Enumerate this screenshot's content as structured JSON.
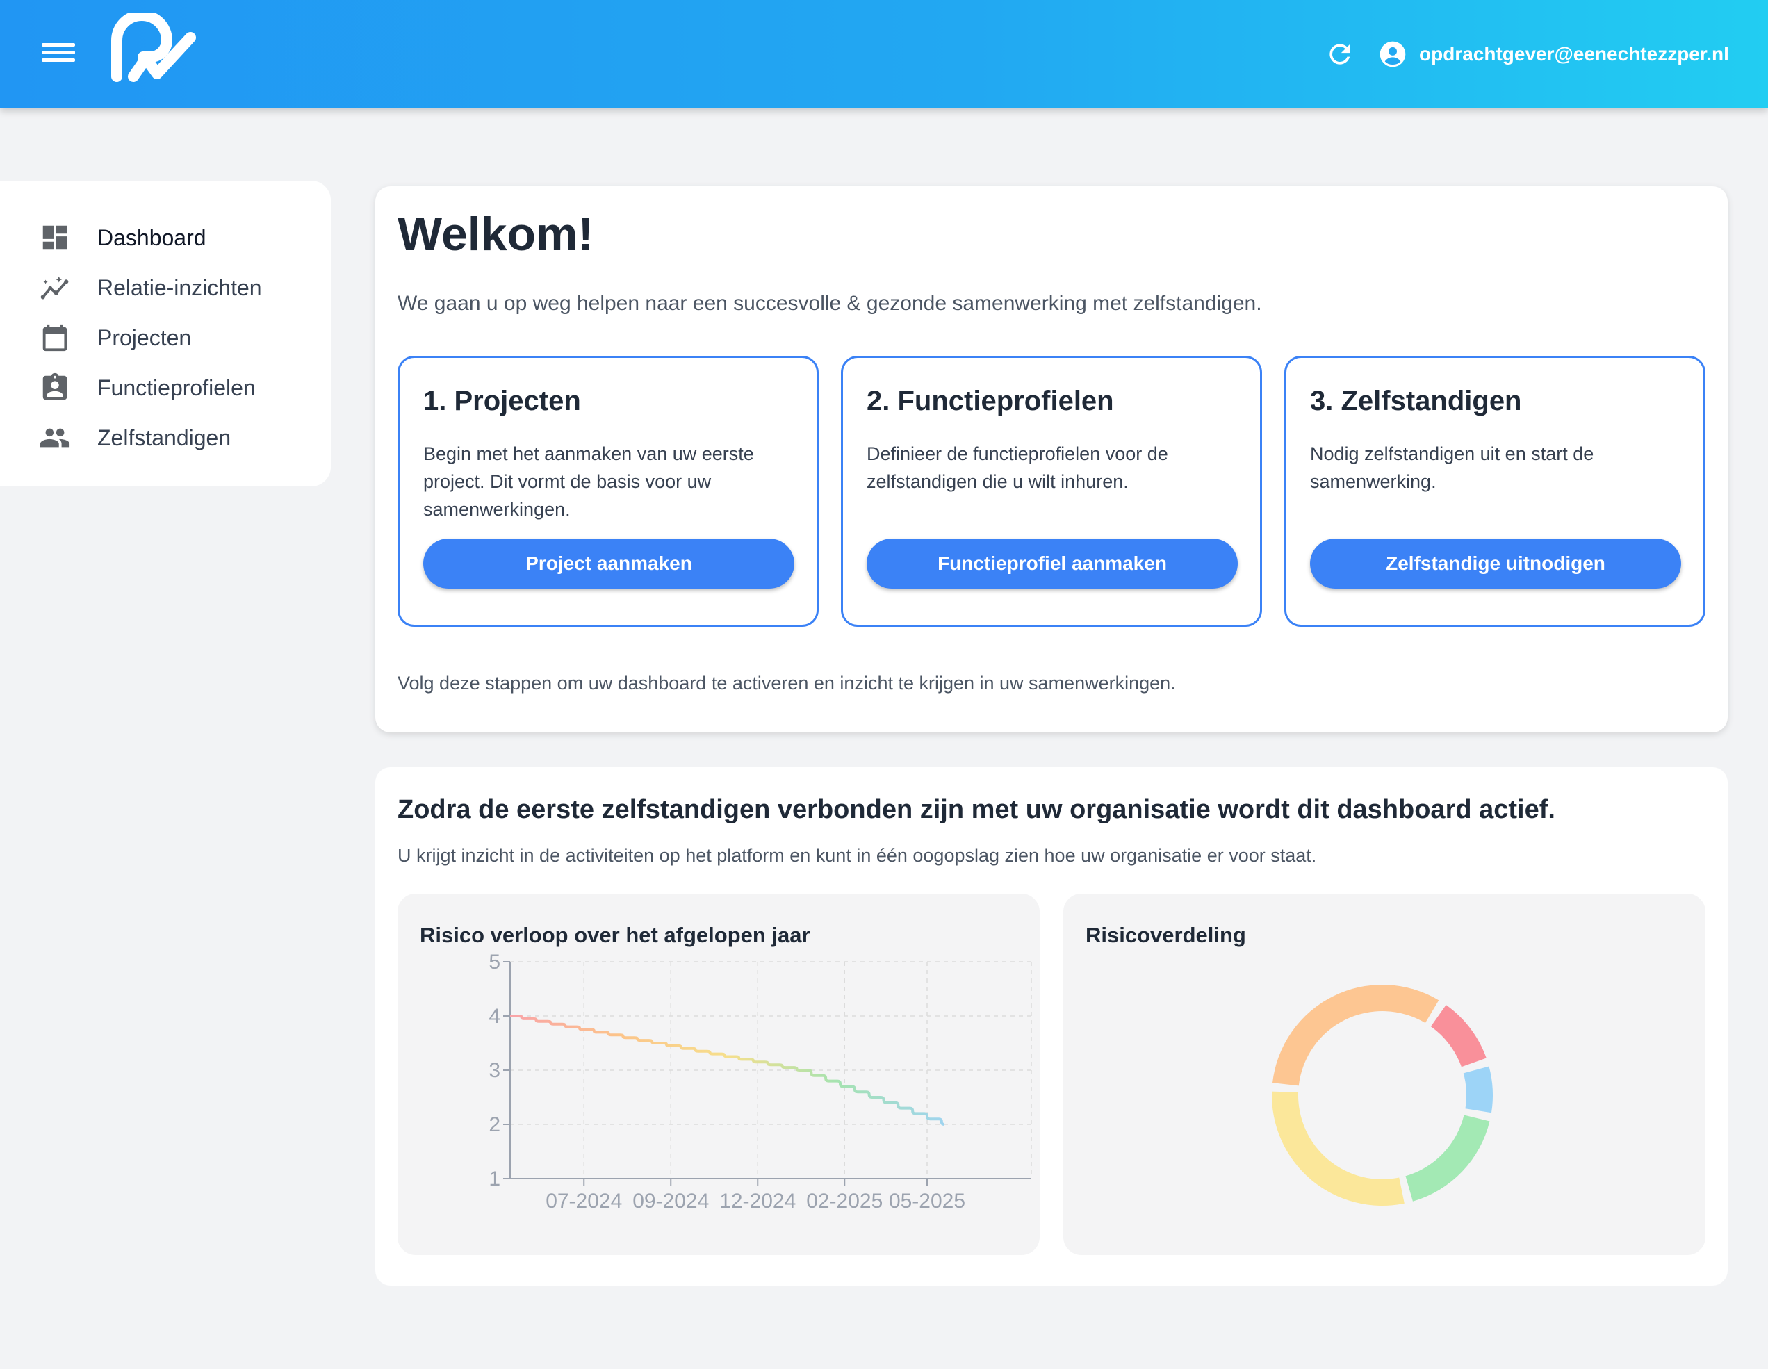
{
  "header": {
    "user_email": "opdrachtgever@eenechtezzper.nl",
    "icons": [
      "menu-icon",
      "logo",
      "refresh-icon",
      "account-circle-icon"
    ],
    "gradient": [
      "#2196f3",
      "#22cdf2"
    ]
  },
  "sidebar": {
    "items": [
      {
        "label": "Dashboard",
        "icon": "dashboard-icon"
      },
      {
        "label": "Relatie-inzichten",
        "icon": "insights-icon"
      },
      {
        "label": "Projecten",
        "icon": "calendar-icon"
      },
      {
        "label": "Functieprofielen",
        "icon": "badge-icon"
      },
      {
        "label": "Zelfstandigen",
        "icon": "people-icon"
      }
    ]
  },
  "welcome": {
    "title": "Welkom!",
    "subtitle": "We gaan u op weg helpen naar een succesvolle & gezonde samenwerking met zelfstandigen.",
    "steps": [
      {
        "title": "1. Projecten",
        "lines": [
          "Begin met het aanmaken van uw eerste",
          "project. Dit vormt de basis voor uw",
          "samenwerkingen."
        ],
        "button": "Project aanmaken"
      },
      {
        "title": "2. Functieprofielen",
        "lines": [
          "Definieer de functieprofielen voor de",
          "zelfstandigen die u wilt inhuren."
        ],
        "button": "Functieprofiel aanmaken"
      },
      {
        "title": "3. Zelfstandigen",
        "lines": [
          "Nodig zelfstandigen uit en start de",
          "samenwerking."
        ],
        "button": "Zelfstandige uitnodigen"
      }
    ],
    "footer": "Volg deze stappen om uw dashboard te activeren en inzicht te krijgen in uw samenwerkingen.",
    "accent": "#3b82f6"
  },
  "dashboard": {
    "title": "Zodra de eerste zelfstandigen verbonden zijn met uw organisatie wordt dit dashboard actief.",
    "subtitle": "U krijgt inzicht in de activiteiten op het platform en kunt in één oogopslag zien hoe uw organisatie er voor staat.",
    "line_panel_title": "Risico verloop over het afgelopen jaar",
    "donut_panel_title": "Risicoverdeling"
  },
  "chart_data": [
    {
      "type": "line",
      "title": "Risico verloop over het afgelopen jaar",
      "xlabel": "",
      "ylabel": "",
      "xlim": [
        0,
        12
      ],
      "ylim": [
        1,
        5
      ],
      "yticks": [
        1,
        2,
        3,
        4,
        5
      ],
      "xticks": [
        {
          "label": "07-2024",
          "x": 1.7
        },
        {
          "label": "09-2024",
          "x": 3.7
        },
        {
          "label": "12-2024",
          "x": 5.7
        },
        {
          "label": "02-2025",
          "x": 7.7
        },
        {
          "label": "05-2025",
          "x": 9.6
        }
      ],
      "grid": true,
      "series": [
        {
          "x": [
            0,
            0.333,
            0.667,
            1,
            1.333,
            1.667,
            2,
            2.333,
            2.667,
            3,
            3.333,
            3.667,
            4,
            4.333,
            4.667,
            5,
            5.333,
            5.667,
            6,
            6.333,
            6.667,
            7,
            7.333,
            7.667,
            8,
            8.333,
            8.667,
            9,
            9.333,
            9.667,
            10
          ],
          "y": [
            4.0,
            3.95,
            3.9,
            3.85,
            3.8,
            3.75,
            3.7,
            3.65,
            3.6,
            3.55,
            3.5,
            3.45,
            3.4,
            3.35,
            3.3,
            3.25,
            3.2,
            3.15,
            3.1,
            3.05,
            3.0,
            2.9,
            2.8,
            2.7,
            2.6,
            2.5,
            2.4,
            2.3,
            2.2,
            2.1,
            2.0
          ],
          "gradient": [
            "#f9a3a8",
            "#fcc48a",
            "#f6df8c",
            "#a6e3b0",
            "#9fd4ef"
          ]
        }
      ]
    },
    {
      "type": "pie",
      "title": "Risicoverdeling",
      "slices": [
        {
          "value": 11,
          "color": "#f9909a"
        },
        {
          "value": 8,
          "color": "#9dd4f7"
        },
        {
          "value": 18,
          "color": "#a3e9b4"
        },
        {
          "value": 30,
          "color": "#fbe79a"
        },
        {
          "value": 33,
          "color": "#fdc692"
        }
      ]
    }
  ]
}
